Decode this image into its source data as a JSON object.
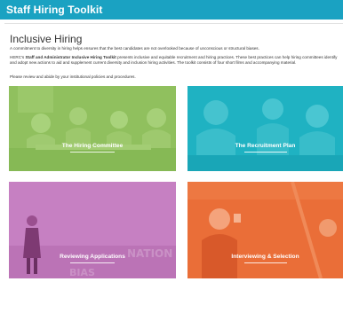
{
  "header": {
    "title": "Staff Hiring Toolkit",
    "bar_color": "#1aa2c2"
  },
  "intro": {
    "page_title": "Inclusive Hiring",
    "lead": "A commitment to diversity in hiring helps ensures that the best candidates are not overlooked because of unconscious or structural biases.",
    "para_prefix": "HERC's ",
    "para_bold": "Staff and Administrator Inclusive Hiring Toolkit",
    "para_rest": " presents inclusive and equitable recruitment and hiring practices. These best practices can help hiring committees identify and adopt new actions to aid and supplement current diversity and inclusion hiring activities. The toolkit consists of four short films and accompanying material.",
    "note": "Please review and abide by your institutional policies and procedures."
  },
  "tiles": [
    {
      "label": "The Hiring Committee",
      "color": "#8fbf5e"
    },
    {
      "label": "The Recruitment Plan",
      "color": "#20b3c3"
    },
    {
      "label": "Reviewing Applications",
      "color": "#c57ec2",
      "bg_words": [
        "NATION",
        "BIAS"
      ]
    },
    {
      "label": "Interviewing & Selection",
      "color": "#ea6d37"
    }
  ]
}
